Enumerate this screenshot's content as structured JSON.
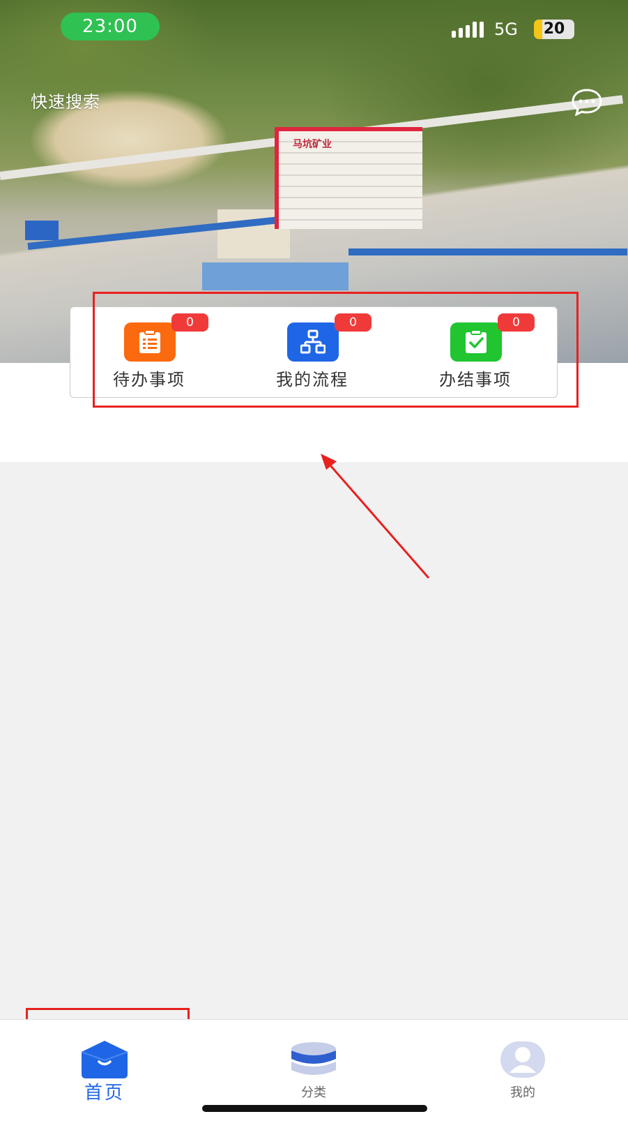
{
  "status_bar": {
    "time": "23:00",
    "network": "5G",
    "battery": "20"
  },
  "header": {
    "quick_search": "快速搜索",
    "message_icon": "chat-bubble-icon"
  },
  "banner": {
    "sign_text": "马坑矿业"
  },
  "quick_actions": [
    {
      "label": "待办事项",
      "count": "0",
      "icon": "clipboard-list-icon",
      "color": "#fb6a0f"
    },
    {
      "label": "我的流程",
      "count": "0",
      "icon": "flow-chart-icon",
      "color": "#1f66e6"
    },
    {
      "label": "办结事项",
      "count": "0",
      "icon": "clipboard-check-icon",
      "color": "#20c530"
    }
  ],
  "tab_bar": {
    "tabs": [
      {
        "label": "首页",
        "icon": "home-tab-icon",
        "active": true
      },
      {
        "label": "分类",
        "icon": "category-stack-icon",
        "active": false
      },
      {
        "label": "我的",
        "icon": "profile-icon",
        "active": false
      }
    ]
  },
  "colors": {
    "accent": "#1f66e6",
    "badge": "#f03a3a",
    "highlight": "#e8211f",
    "status_time_bg": "#2fc152"
  }
}
